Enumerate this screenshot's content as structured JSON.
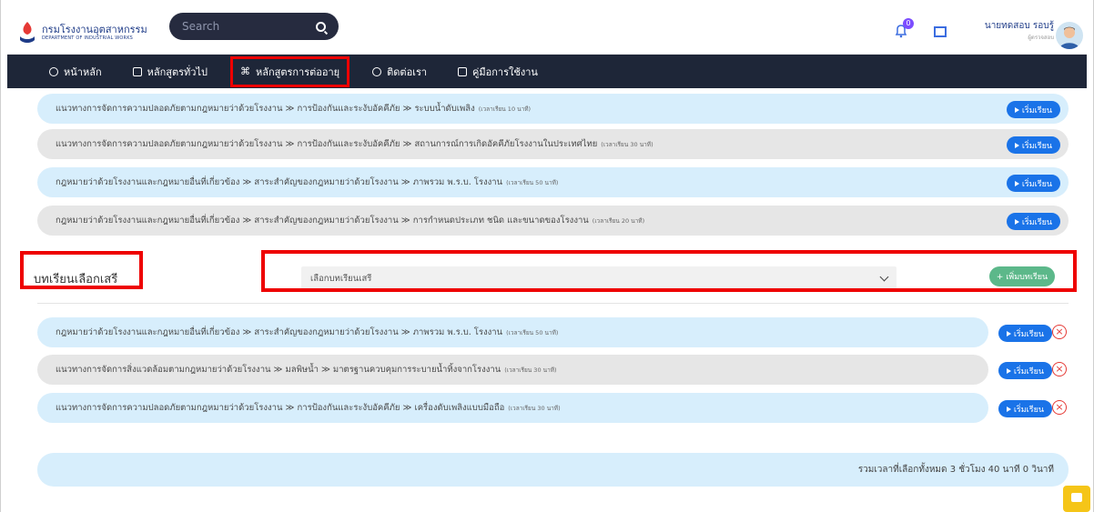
{
  "header": {
    "logo_th": "กรมโรงงานอุตสาหกรรม",
    "logo_en": "DEPARTMENT OF INDUSTRIAL WORKS",
    "search_placeholder": "Search",
    "notification_count": "0",
    "user_name": "นายทดสอบ รอบรู้",
    "user_role": "ผู้ตรวจสอบ"
  },
  "nav": {
    "items": [
      {
        "label": "หน้าหลัก",
        "icon": "home-icon"
      },
      {
        "label": "หลักสูตรทั่วไป",
        "icon": "square-icon"
      },
      {
        "label": "หลักสูตรการต่ออายุ",
        "icon": "command-icon"
      },
      {
        "label": "ติดต่อเรา",
        "icon": "chat-icon"
      },
      {
        "label": "คู่มือการใช้งาน",
        "icon": "book-icon"
      }
    ]
  },
  "required_lessons": [
    {
      "path": "แนวทางการจัดการความปลอดภัยตามกฎหมายว่าด้วยโรงงาน ≫ การป้องกันและระงับอัคคีภัย ≫ ระบบน้ำดับเพลิง",
      "duration": "(เวลาเรียน 10 นาที)",
      "button": "เริ่มเรียน"
    },
    {
      "path": "แนวทางการจัดการความปลอดภัยตามกฎหมายว่าด้วยโรงงาน ≫ การป้องกันและระงับอัคคีภัย ≫ สถานการณ์การเกิดอัคคีภัยโรงงานในประเทศไทย",
      "duration": "(เวลาเรียน 30 นาที)",
      "button": "เริ่มเรียน"
    },
    {
      "path": "กฎหมายว่าด้วยโรงงานและกฎหมายอื่นที่เกี่ยวข้อง ≫ สาระสำคัญของกฎหมายว่าด้วยโรงงาน ≫ ภาพรวม พ.ร.บ. โรงงาน",
      "duration": "(เวลาเรียน 50 นาที)",
      "button": "เริ่มเรียน"
    },
    {
      "path": "กฎหมายว่าด้วยโรงงานและกฎหมายอื่นที่เกี่ยวข้อง ≫ สาระสำคัญของกฎหมายว่าด้วยโรงงาน ≫ การกำหนดประเภท ชนิด และขนาดของโรงงาน",
      "duration": "(เวลาเรียน 20 นาที)",
      "button": "เริ่มเรียน"
    }
  ],
  "elective": {
    "title": "บทเรียนเลือกเสรี",
    "select_value": "เลือกบทเรียนเสรี",
    "add_button": "+ เพิ่มบทเรียน"
  },
  "selected_lessons": [
    {
      "path": "กฎหมายว่าด้วยโรงงานและกฎหมายอื่นที่เกี่ยวข้อง ≫ สาระสำคัญของกฎหมายว่าด้วยโรงงาน ≫ ภาพรวม พ.ร.บ. โรงงาน",
      "duration": "(เวลาเรียน 50 นาที)",
      "button": "เริ่มเรียน"
    },
    {
      "path": "แนวทางการจัดการสิ่งแวดล้อมตามกฎหมายว่าด้วยโรงงาน ≫ มลพิษน้ำ ≫ มาตรฐานควบคุมการระบายน้ำทิ้งจากโรงงาน",
      "duration": "(เวลาเรียน 30 นาที)",
      "button": "เริ่มเรียน"
    },
    {
      "path": "แนวทางการจัดการความปลอดภัยตามกฎหมายว่าด้วยโรงงาน ≫ การป้องกันและระงับอัคคีภัย ≫ เครื่องดับเพลิงแบบมือถือ",
      "duration": "(เวลาเรียน 30 นาที)",
      "button": "เริ่มเรียน"
    }
  ],
  "total": "รวมเวลาที่เลือกทั้งหมด 3 ชั่วโมง 40 นาที 0 วินาที",
  "colors": {
    "nav_bg": "#1e2638",
    "accent": "#1a73e8",
    "highlight": "#e00000",
    "add_button": "#5cb88a"
  }
}
